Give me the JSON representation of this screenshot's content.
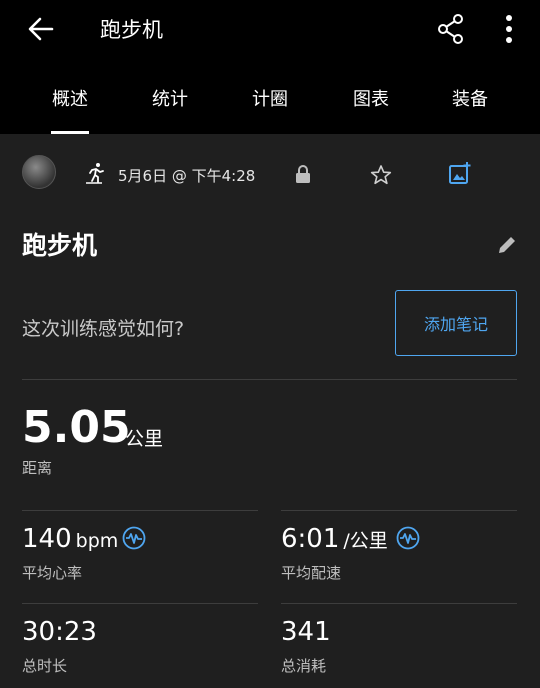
{
  "header": {
    "title": "跑步机",
    "back_icon": "arrow-left-icon",
    "share_icon": "share-icon",
    "more_icon": "more-vert-icon"
  },
  "tabs": [
    {
      "label": "概述",
      "active": true
    },
    {
      "label": "统计",
      "active": false
    },
    {
      "label": "计圈",
      "active": false
    },
    {
      "label": "图表",
      "active": false
    },
    {
      "label": "装备",
      "active": false
    }
  ],
  "activity": {
    "datetime": "5月6日 @ 下午4:28",
    "name": "跑步机",
    "feel_prompt": "这次训练感觉如何?",
    "add_note_label": "添加笔记"
  },
  "distance": {
    "value": "5.05",
    "unit": "公里",
    "label": "距离"
  },
  "stats": {
    "avg_hr": {
      "value": "140",
      "unit": "bpm",
      "label": "平均心率"
    },
    "avg_pace": {
      "value": "6:01",
      "unit": "/公里",
      "label": "平均配速"
    },
    "total_time": {
      "value": "30:23",
      "label": "总时长"
    },
    "calories": {
      "value": "341",
      "label": "总消耗"
    }
  },
  "colors": {
    "accent": "#4fa6f0",
    "background": "#1f1f1f",
    "topbar": "#000000"
  }
}
